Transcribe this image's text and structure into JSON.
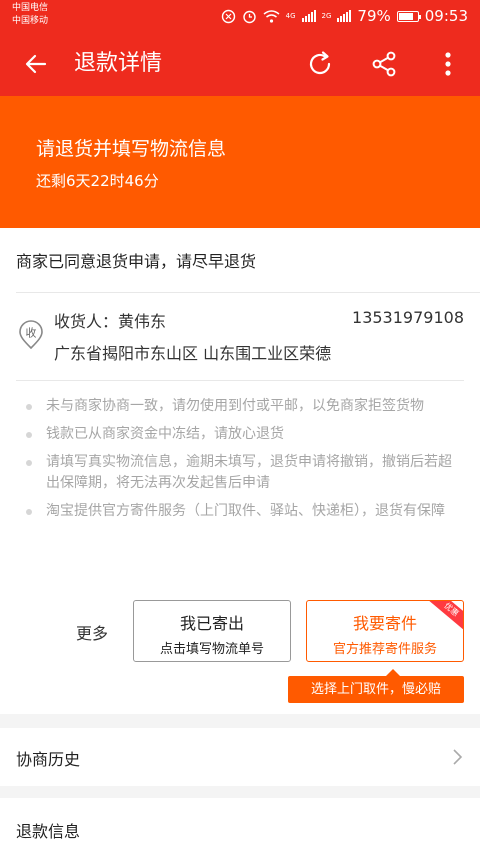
{
  "status_bar": {
    "carrier_1": "中国电信",
    "carrier_2": "中国移动",
    "net_1": "4G",
    "net_2": "2G",
    "battery": "79%",
    "time": "09:53"
  },
  "navbar": {
    "title": "退款详情",
    "back_icon": "back-arrow-icon",
    "refresh_icon": "refresh-icon",
    "share_icon": "share-icon",
    "more_icon": "more-vertical-icon",
    "bg_color": "#ee2b1e"
  },
  "banner": {
    "title": "请退货并填写物流信息",
    "countdown": "还剩6天22时46分",
    "bg_color": "#ff5a00"
  },
  "notice": {
    "text": "商家已同意退货申请，请尽早退货"
  },
  "receiver": {
    "icon_text": "收",
    "name_label": "收货人：黄伟东",
    "phone": "13531979108",
    "address": "广东省揭阳市东山区 山东围工业区荣德"
  },
  "tips": [
    "未与商家协商一致，请勿使用到付或平邮，以免商家拒签货物",
    "钱款已从商家资金中冻结，请放心退货",
    "请填写真实物流信息，逾期未填写，退货申请将撤销，撤销后若超出保障期，将无法再次发起售后申请",
    "淘宝提供官方寄件服务（上门取件、驿站、快递柜），退货有保障"
  ],
  "actions": {
    "more": "更多",
    "sent_title": "我已寄出",
    "sent_sub": "点击填写物流单号",
    "ship_title": "我要寄件",
    "ship_sub": "官方推荐寄件服务",
    "ship_badge": "优惠",
    "promo": "选择上门取件，慢必赔"
  },
  "history": {
    "label": "协商历史"
  },
  "refund_info": {
    "label": "退款信息"
  }
}
